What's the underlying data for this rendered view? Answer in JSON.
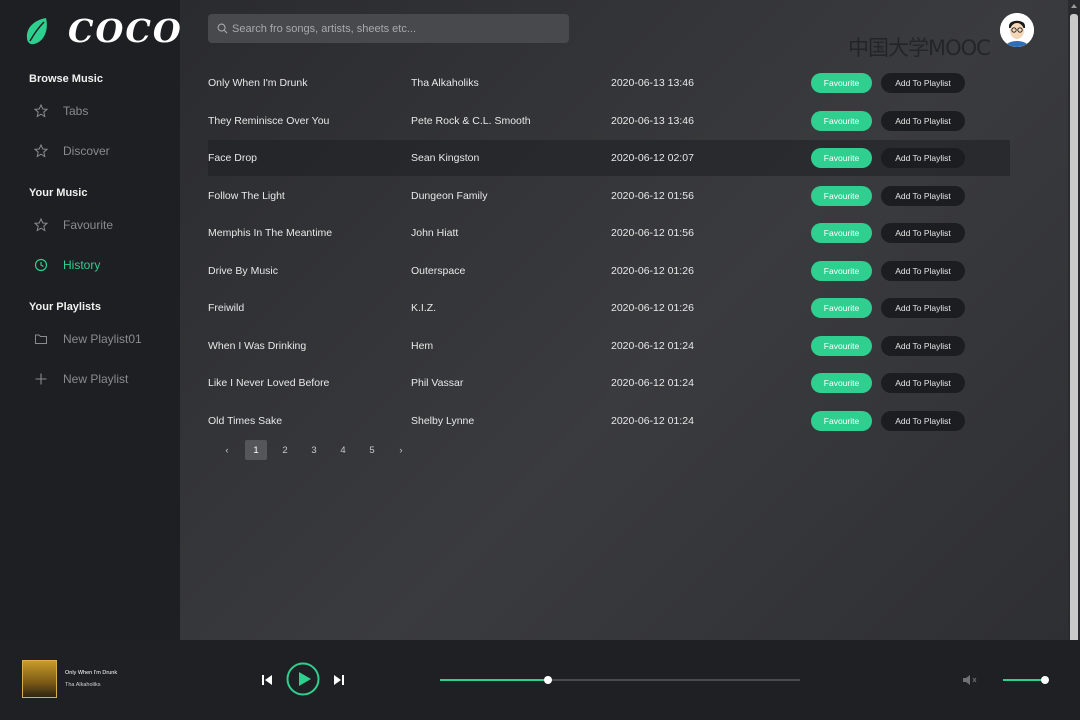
{
  "app": {
    "logo_text": "COCO",
    "watermark": "中国大学MOOC"
  },
  "sidebar": {
    "sections": [
      {
        "title": "Browse Music",
        "items": [
          {
            "label": "Tabs",
            "icon": "star-icon"
          },
          {
            "label": "Discover",
            "icon": "star-icon"
          }
        ]
      },
      {
        "title": "Your Music",
        "items": [
          {
            "label": "Favourite",
            "icon": "star-icon"
          },
          {
            "label": "History",
            "icon": "clock-icon",
            "active": true
          }
        ]
      },
      {
        "title": "Your Playlists",
        "items": [
          {
            "label": "New Playlist01",
            "icon": "folder-icon"
          },
          {
            "label": "New Playlist",
            "icon": "plus-icon"
          }
        ]
      }
    ]
  },
  "search": {
    "placeholder": "Search fro songs, artists, sheets etc..."
  },
  "songs": [
    {
      "title": "Only When I'm Drunk",
      "artist": "Tha Alkaholiks",
      "time": "2020-06-13 13:46"
    },
    {
      "title": "They Reminisce Over You",
      "artist": "Pete Rock & C.L. Smooth",
      "time": "2020-06-13 13:46"
    },
    {
      "title": "Face Drop",
      "artist": "Sean Kingston",
      "time": "2020-06-12 02:07",
      "highlighted": true
    },
    {
      "title": "Follow The Light",
      "artist": "Dungeon Family",
      "time": "2020-06-12 01:56"
    },
    {
      "title": "Memphis In The Meantime",
      "artist": "John Hiatt",
      "time": "2020-06-12 01:56"
    },
    {
      "title": "Drive By Music",
      "artist": "Outerspace",
      "time": "2020-06-12 01:26"
    },
    {
      "title": "Freiwild",
      "artist": "K.I.Z.",
      "time": "2020-06-12 01:26"
    },
    {
      "title": "When I Was Drinking",
      "artist": "Hem",
      "time": "2020-06-12 01:24"
    },
    {
      "title": "Like I Never Loved Before",
      "artist": "Phil Vassar",
      "time": "2020-06-12 01:24"
    },
    {
      "title": "Old Times Sake",
      "artist": "Shelby Lynne",
      "time": "2020-06-12 01:24"
    }
  ],
  "row_actions": {
    "favourite_label": "Favourite",
    "add_label": "Add To Playlist"
  },
  "pagination": {
    "prev": "‹",
    "next": "›",
    "pages": [
      "1",
      "2",
      "3",
      "4",
      "5"
    ],
    "current": "1"
  },
  "player": {
    "now_playing_title": "Only When I'm Drunk",
    "now_playing_artist": "Tha Alkaholiks",
    "progress": 0.3,
    "volume": 0.95
  },
  "colors": {
    "accent": "#2ecf8f",
    "sidebar_bg": "#1e1f22",
    "player_bg": "#1f2023"
  }
}
